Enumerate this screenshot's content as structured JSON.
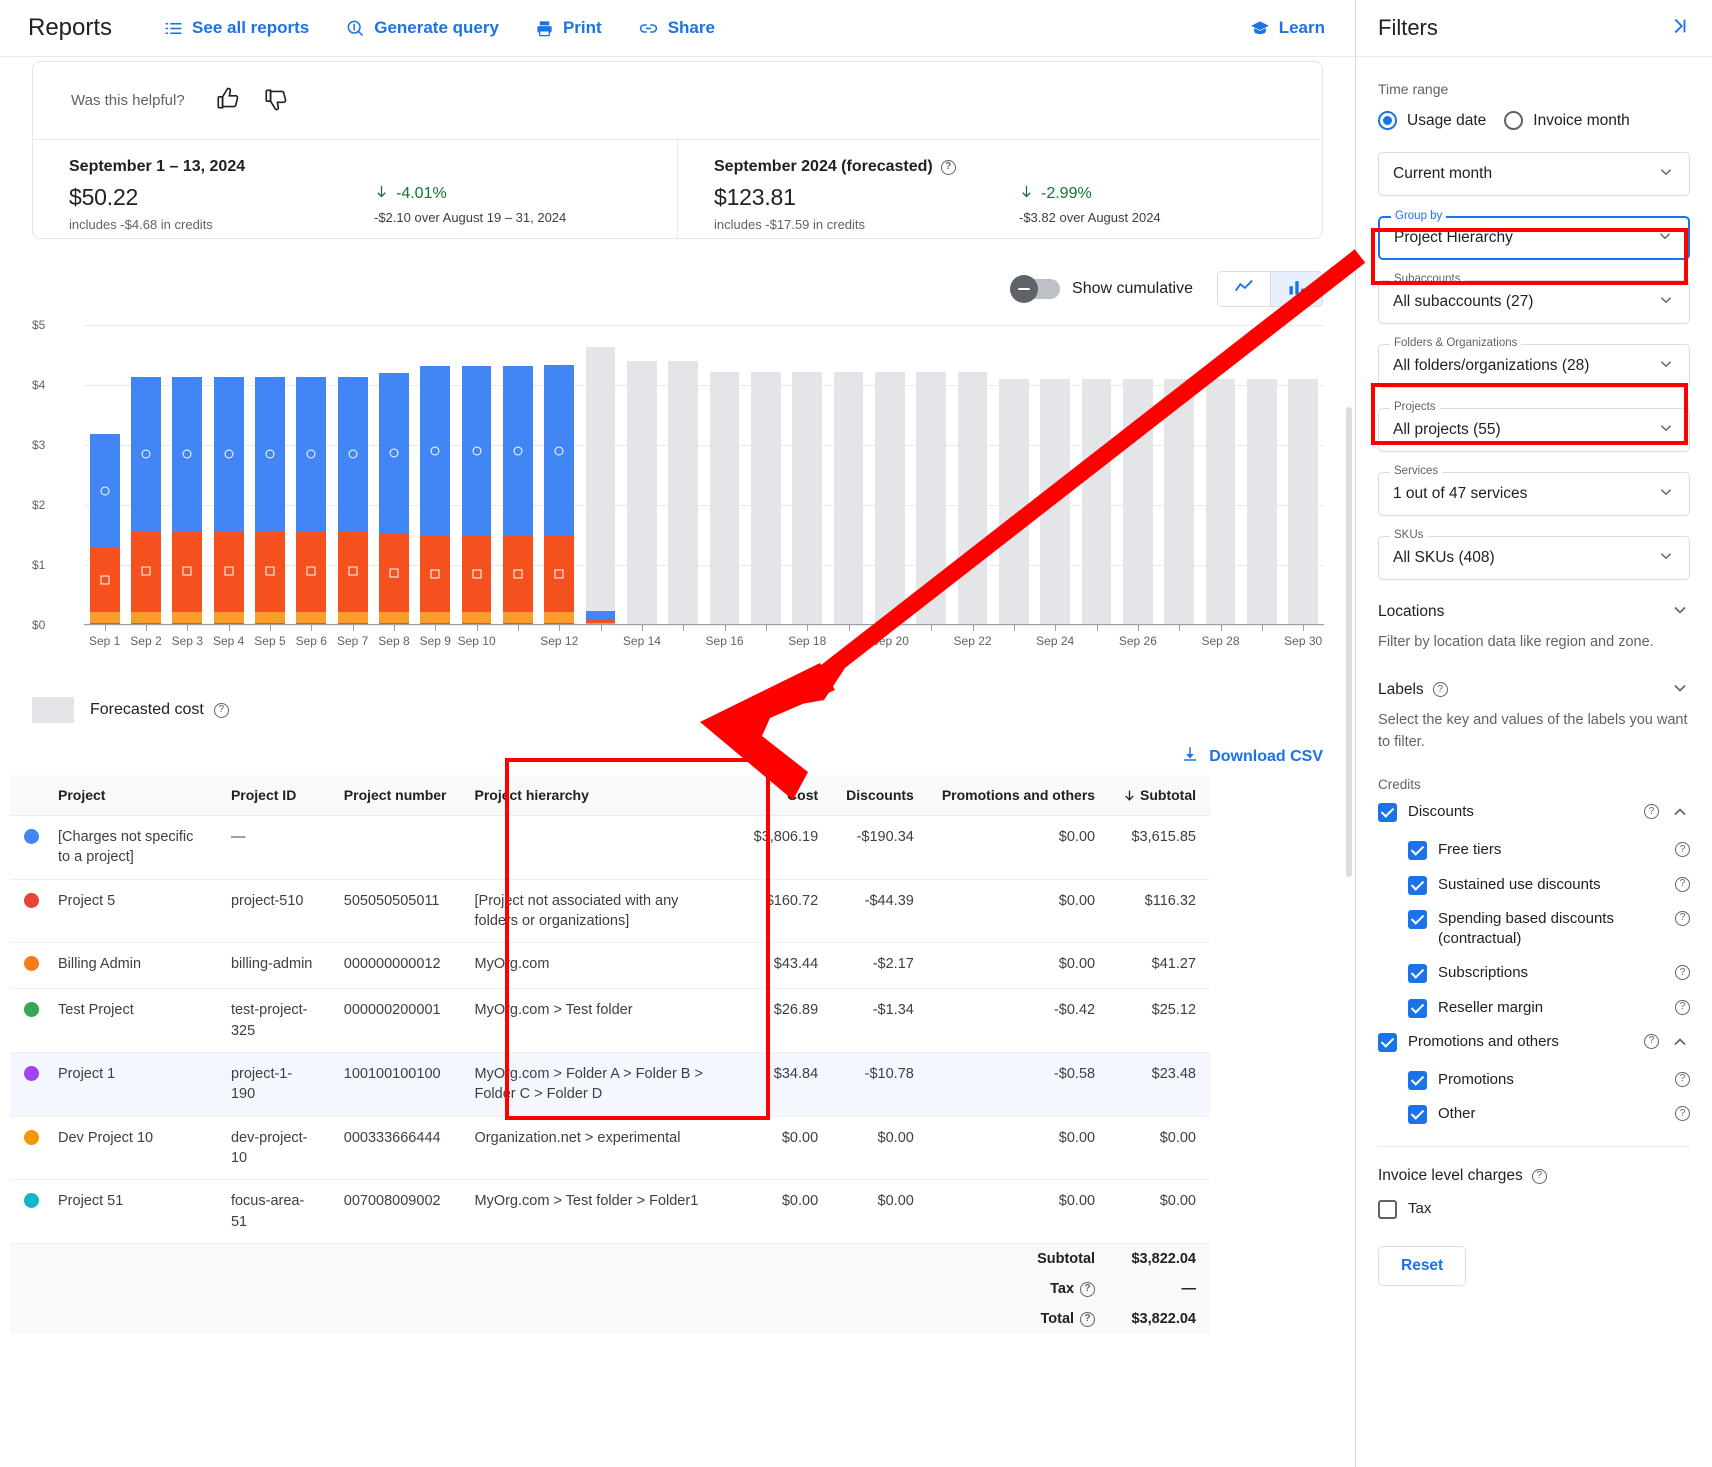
{
  "topbar": {
    "title": "Reports",
    "actions": [
      {
        "label": "See all reports",
        "icon": "list-icon"
      },
      {
        "label": "Generate query",
        "icon": "query-icon"
      },
      {
        "label": "Print",
        "icon": "print-icon"
      },
      {
        "label": "Share",
        "icon": "share-icon"
      }
    ],
    "learn": "Learn"
  },
  "feedback": {
    "question": "Was this helpful?",
    "thumb_up": "thumb-up",
    "thumb_down": "thumb-down"
  },
  "summary": {
    "left": {
      "title": "September 1 – 13, 2024",
      "amount": "$50.22",
      "credits": "includes -$4.68 in credits",
      "delta": "-4.01%",
      "delta_sub": "-$2.10 over August 19 – 31, 2024"
    },
    "right": {
      "title": "September 2024 (forecasted)",
      "amount": "$123.81",
      "credits": "includes -$17.59 in credits",
      "delta": "-2.99%",
      "delta_sub": "-$3.82 over August 2024"
    }
  },
  "chart_toolbar": {
    "cumulative_label": "Show cumulative",
    "cumulative_on": false,
    "line_view": "line-chart-icon",
    "bar_view": "bar-chart-icon",
    "active_view": "bar"
  },
  "legend": {
    "label": "Forecasted cost"
  },
  "download": {
    "label": "Download CSV"
  },
  "chart_data": {
    "type": "bar",
    "title": "",
    "xlabel": "",
    "ylabel": "",
    "ylim": [
      0,
      5
    ],
    "yticks": [
      "$0",
      "$1",
      "$2",
      "$3",
      "$4",
      "$5"
    ],
    "grid": true,
    "stacked": true,
    "legend_position": "below",
    "colors": {
      "charges_not_specific": "#4285f4",
      "project_5": "#ea4335",
      "billing_admin": "#fa7b17",
      "test_project": "#34a853",
      "forecast": "#e3e5e8"
    },
    "categories": [
      "Sep 1",
      "Sep 2",
      "Sep 3",
      "Sep 4",
      "Sep 5",
      "Sep 6",
      "Sep 7",
      "Sep 8",
      "Sep 9",
      "Sep 10",
      "Sep 11",
      "Sep 12",
      "Sep 13",
      "Sep 14",
      "Sep 15",
      "Sep 16",
      "Sep 17",
      "Sep 18",
      "Sep 19",
      "Sep 20",
      "Sep 21",
      "Sep 22",
      "Sep 23",
      "Sep 24",
      "Sep 25",
      "Sep 26",
      "Sep 27",
      "Sep 28",
      "Sep 29",
      "Sep 30"
    ],
    "tick_labels": [
      "Sep 1",
      "Sep 2",
      "Sep 3",
      "Sep 4",
      "Sep 5",
      "Sep 6",
      "Sep 7",
      "Sep 8",
      "Sep 9",
      "Sep 10",
      "",
      "Sep 12",
      "",
      "Sep 14",
      "",
      "Sep 16",
      "",
      "Sep 18",
      "",
      "Sep 20",
      "",
      "Sep 22",
      "",
      "Sep 24",
      "",
      "Sep 26",
      "",
      "Sep 28",
      "",
      "Sep 30"
    ],
    "series": [
      {
        "name": "Test Project",
        "color": "#34a853",
        "marker": "none",
        "values": [
          0.04,
          0.04,
          0.04,
          0.04,
          0.04,
          0.04,
          0.04,
          0.04,
          0.04,
          0.04,
          0.04,
          0.04,
          0.0,
          0,
          0,
          0,
          0,
          0,
          0,
          0,
          0,
          0,
          0,
          0,
          0,
          0,
          0,
          0,
          0,
          0
        ]
      },
      {
        "name": "Billing Admin",
        "color": "#fa9d2b",
        "marker": "diamond",
        "values": [
          0.17,
          0.18,
          0.18,
          0.18,
          0.18,
          0.18,
          0.18,
          0.18,
          0.18,
          0.18,
          0.18,
          0.18,
          0.04,
          0,
          0,
          0,
          0,
          0,
          0,
          0,
          0,
          0,
          0,
          0,
          0,
          0,
          0,
          0,
          0,
          0
        ]
      },
      {
        "name": "Project 5",
        "color": "#f4511e",
        "marker": "square",
        "values": [
          1.07,
          1.35,
          1.35,
          1.35,
          1.35,
          1.35,
          1.35,
          1.31,
          1.26,
          1.26,
          1.26,
          1.26,
          0.06,
          0,
          0,
          0,
          0,
          0,
          0,
          0,
          0,
          0,
          0,
          0,
          0,
          0,
          0,
          0,
          0,
          0
        ]
      },
      {
        "name": "[Charges not specific to a project]",
        "color": "#4285f4",
        "marker": "circle",
        "values": [
          1.91,
          2.57,
          2.57,
          2.57,
          2.57,
          2.57,
          2.57,
          2.67,
          2.83,
          2.83,
          2.83,
          2.85,
          0.13,
          0,
          0,
          0,
          0,
          0,
          0,
          0,
          0,
          0,
          0,
          0,
          0,
          0,
          0,
          0,
          0,
          0
        ]
      },
      {
        "name": "Forecasted cost",
        "color": "#e3e5e8",
        "marker": "none",
        "values": [
          0,
          0,
          0,
          0,
          0,
          0,
          0,
          0,
          0,
          0,
          0,
          0,
          4.4,
          4.4,
          4.4,
          4.22,
          4.22,
          4.22,
          4.22,
          4.22,
          4.22,
          4.22,
          4.1,
          4.1,
          4.1,
          4.1,
          4.1,
          4.1,
          4.1,
          4.1
        ]
      }
    ]
  },
  "table": {
    "columns": [
      "Project",
      "Project ID",
      "Project number",
      "Project hierarchy",
      "Cost",
      "Discounts",
      "Promotions and others",
      "Subtotal"
    ],
    "sorted_column": "Subtotal",
    "sort_icon": "arrow-down-icon",
    "rows": [
      {
        "dot": "#4285f4",
        "project": "[Charges not specific to a project]",
        "project_id": "—",
        "project_number": "",
        "hierarchy": "",
        "cost": "$3,806.19",
        "discounts": "-$190.34",
        "promotions": "$0.00",
        "subtotal": "$3,615.85",
        "highlight": false
      },
      {
        "dot": "#ea4335",
        "project": "Project 5",
        "project_id": "project-510",
        "project_number": "505050505011",
        "hierarchy": "[Project not associated with any folders or organizations]",
        "cost": "$160.72",
        "discounts": "-$44.39",
        "promotions": "$0.00",
        "subtotal": "$116.32",
        "highlight": false
      },
      {
        "dot": "#fa7b17",
        "project": "Billing Admin",
        "project_id": "billing-admin",
        "project_number": "000000000012",
        "hierarchy": "MyOrg.com",
        "cost": "$43.44",
        "discounts": "-$2.17",
        "promotions": "$0.00",
        "subtotal": "$41.27",
        "highlight": false
      },
      {
        "dot": "#34a853",
        "project": "Test Project",
        "project_id": "test-project-325",
        "project_number": "000000200001",
        "hierarchy": "MyOrg.com > Test folder",
        "cost": "$26.89",
        "discounts": "-$1.34",
        "promotions": "-$0.42",
        "subtotal": "$25.12",
        "highlight": false
      },
      {
        "dot": "#a142f4",
        "project": "Project 1",
        "project_id": "project-1-190",
        "project_number": "100100100100",
        "hierarchy": "MyOrg.com > Folder A > Folder B > Folder C > Folder D",
        "cost": "$34.84",
        "discounts": "-$10.78",
        "promotions": "-$0.58",
        "subtotal": "$23.48",
        "highlight": true
      },
      {
        "dot": "#f29900",
        "project": "Dev Project 10",
        "project_id": "dev-project-10",
        "project_number": "000333666444",
        "hierarchy": "Organization.net > experimental",
        "cost": "$0.00",
        "discounts": "$0.00",
        "promotions": "$0.00",
        "subtotal": "$0.00",
        "highlight": false
      },
      {
        "dot": "#12b5cb",
        "project": "Project 51",
        "project_id": "focus-area-51",
        "project_number": "007008009002",
        "hierarchy": "MyOrg.com > Test folder > Folder1",
        "cost": "$0.00",
        "discounts": "$0.00",
        "promotions": "$0.00",
        "subtotal": "$0.00",
        "highlight": false
      }
    ],
    "totals": [
      {
        "label": "Subtotal",
        "value": "$3,822.04",
        "help": false
      },
      {
        "label": "Tax",
        "value": "—",
        "help": true
      },
      {
        "label": "Total",
        "value": "$3,822.04",
        "help": true
      }
    ]
  },
  "filters": {
    "title": "Filters",
    "collapse_icon": "collapse-panel-icon",
    "time_range_label": "Time range",
    "radios": [
      {
        "label": "Usage date",
        "selected": true
      },
      {
        "label": "Invoice month",
        "selected": false
      }
    ],
    "selects": [
      {
        "caption": "",
        "value": "Current month",
        "highlighted": false,
        "focused": false
      },
      {
        "caption": "Group by",
        "value": "Project Hierarchy",
        "highlighted": true,
        "focused": true
      },
      {
        "caption": "Subaccounts",
        "value": "All subaccounts (27)",
        "highlighted": false,
        "focused": false
      },
      {
        "caption": "Folders & Organizations",
        "value": "All folders/organizations (28)",
        "highlighted": true,
        "focused": false
      },
      {
        "caption": "Projects",
        "value": "All projects (55)",
        "highlighted": false,
        "focused": false
      },
      {
        "caption": "Services",
        "value": "1 out of 47 services",
        "highlighted": false,
        "focused": false
      },
      {
        "caption": "SKUs",
        "value": "All SKUs (408)",
        "highlighted": false,
        "focused": false
      }
    ],
    "locations": {
      "title": "Locations",
      "description": "Filter by location data like region and zone."
    },
    "labels": {
      "title": "Labels",
      "description": "Select the key and values of the labels you want to filter."
    },
    "credits_label": "Credits",
    "credits": [
      {
        "label": "Discounts",
        "checked": true,
        "indent": false,
        "help": true,
        "chevron": "up"
      },
      {
        "label": "Free tiers",
        "checked": true,
        "indent": true,
        "help": true,
        "chevron": ""
      },
      {
        "label": "Sustained use discounts",
        "checked": true,
        "indent": true,
        "help": true,
        "chevron": ""
      },
      {
        "label": "Spending based discounts (contractual)",
        "checked": true,
        "indent": true,
        "help": true,
        "chevron": ""
      },
      {
        "label": "Subscriptions",
        "checked": true,
        "indent": true,
        "help": true,
        "chevron": ""
      },
      {
        "label": "Reseller margin",
        "checked": true,
        "indent": true,
        "help": true,
        "chevron": ""
      },
      {
        "label": "Promotions and others",
        "checked": true,
        "indent": false,
        "help": true,
        "chevron": "up"
      },
      {
        "label": "Promotions",
        "checked": true,
        "indent": true,
        "help": true,
        "chevron": ""
      },
      {
        "label": "Other",
        "checked": true,
        "indent": true,
        "help": true,
        "chevron": ""
      }
    ],
    "invoice_level": {
      "title": "Invoice level charges",
      "items": [
        {
          "label": "Tax",
          "checked": false
        }
      ]
    },
    "reset_label": "Reset"
  },
  "annotation": {
    "color": "#ff0000"
  }
}
